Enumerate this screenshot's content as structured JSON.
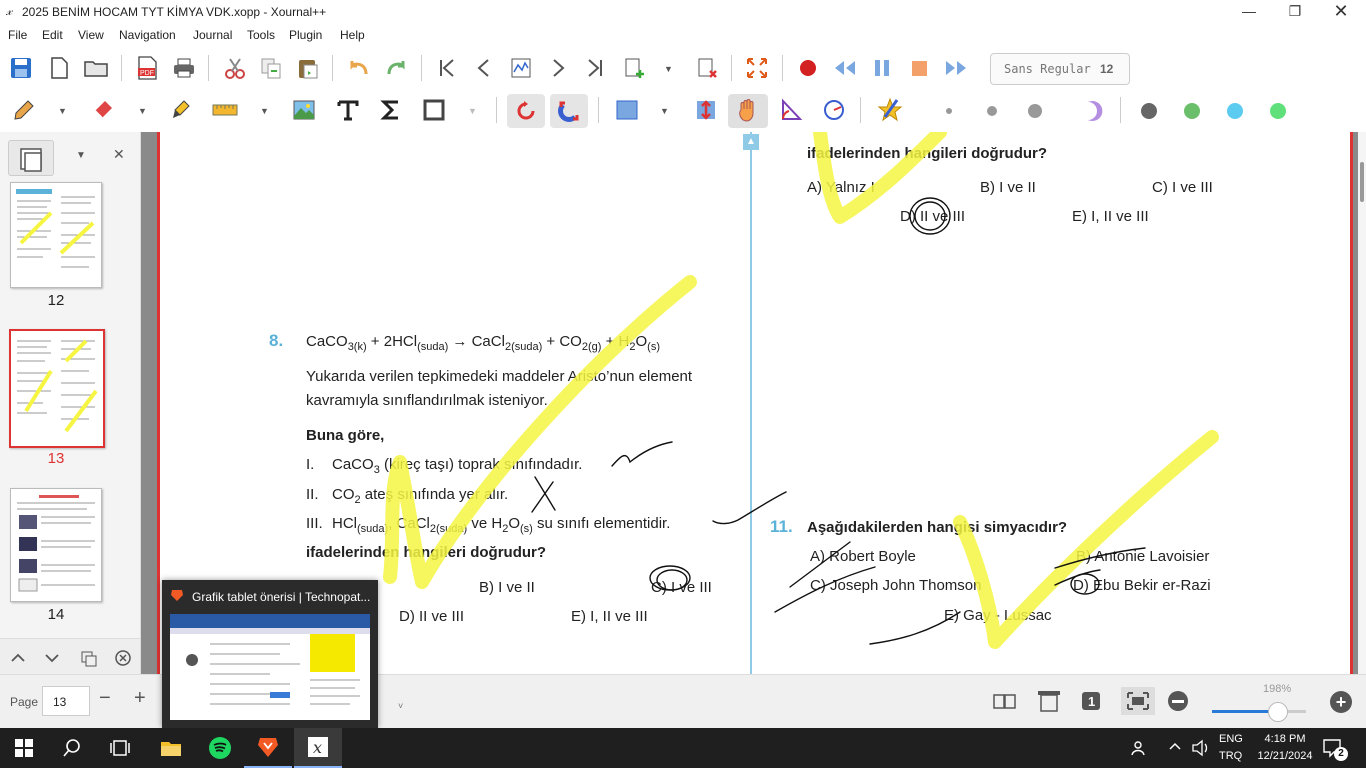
{
  "window": {
    "title": "2025 BENİM HOCAM TYT KİMYA VDK.xopp - Xournal++",
    "app_icon": "xournal-icon"
  },
  "menu": [
    "File",
    "Edit",
    "View",
    "Navigation",
    "Journal",
    "Tools",
    "Plugin",
    "Help"
  ],
  "toolbar": {
    "font_name": "Sans Regular",
    "font_size": "12"
  },
  "sidebar": {
    "pages": [
      {
        "num": "12",
        "selected": false
      },
      {
        "num": "13",
        "selected": true
      },
      {
        "num": "14",
        "selected": false
      }
    ]
  },
  "document": {
    "left": {
      "q8_number": "8.",
      "q8_intro": "Yukarıda verilen tepkimedeki maddeler Aristo’nun element",
      "q8_intro2": "kavramıyla sınıflandırılmak isteniyor.",
      "buna_gore": "Buna göre,",
      "item1_num": "I.",
      "item1_rest": "(kireç taşı) toprak sınıfındadır.",
      "item2_num": "II.",
      "item2_rest": "ateş sınıfında yer alır.",
      "item3_num": "III.",
      "item3_rest": "su sınıfı elementidir.",
      "question": "ifadelerinden hangileri doğrudur?",
      "opt_b": "B) I ve II",
      "opt_c": "C) I ve III",
      "opt_d": "D) II ve III",
      "opt_e": "E) I, II ve III"
    },
    "right": {
      "question_top": "ifadelerinden hangileri doğrudur?",
      "opt_a": "A) Yalnız I",
      "opt_b": "B) I ve II",
      "opt_c": "C) I ve III",
      "opt_d": "D) II ve III",
      "opt_e": "E) I, II ve III",
      "q11_number": "11.",
      "q11_text": "Aşağıdakilerden hangisi simyacıdır?",
      "q11_a": "A) Robert Boyle",
      "q11_b": "B) Antonie Lavoisier",
      "q11_c": "C) Joseph John Thomson",
      "q11_d": "D) Ebu Bekir er-Razi",
      "q11_e": "E) Gay - Lussac"
    }
  },
  "statusbar": {
    "page_label": "Page",
    "page_value": "13",
    "zoom": "198%"
  },
  "popup": {
    "title": "Grafik tablet önerisi | Technopat..."
  },
  "taskbar": {
    "lang1": "ENG",
    "lang2": "TRQ",
    "time": "4:18 PM",
    "date": "12/21/2024",
    "notif": "2"
  },
  "colors": {
    "highlighter": "#f5f542",
    "accent_red": "#d33333",
    "question_number": "#5bb2d8"
  }
}
